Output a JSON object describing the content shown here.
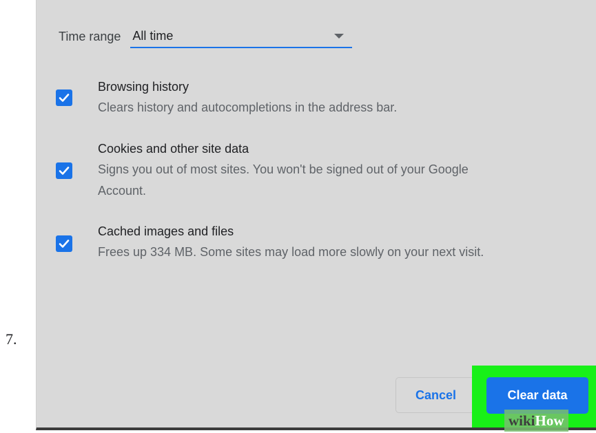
{
  "step_number": "7.",
  "time_range": {
    "label": "Time range",
    "value": "All time"
  },
  "options": [
    {
      "title": "Browsing history",
      "description": "Clears history and autocompletions in the address bar.",
      "checked": true
    },
    {
      "title": "Cookies and other site data",
      "description_line1": "Signs you out of most sites. You won't be signed out of your Google",
      "description_line2": "Account.",
      "checked": true
    },
    {
      "title": "Cached images and files",
      "description": "Frees up 334 MB. Some sites may load more slowly on your next visit.",
      "checked": true
    }
  ],
  "buttons": {
    "cancel": "Cancel",
    "clear": "Clear data"
  },
  "watermark": {
    "part1": "wiki",
    "part2": "How"
  },
  "colors": {
    "accent": "#1a73e8",
    "dialog_background": "#d9d9d9",
    "highlight": "#18f018"
  }
}
